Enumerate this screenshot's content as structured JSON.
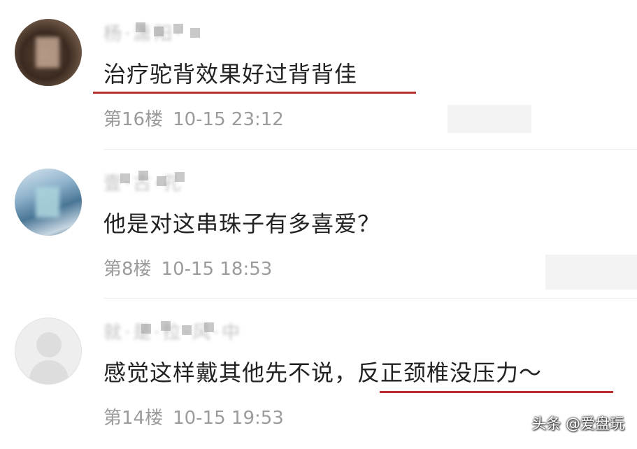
{
  "comments": [
    {
      "username": "杨·潇阳·",
      "text": "治疗驼背效果好过背背佳",
      "floor": "第16楼",
      "time": "10-15 23:12",
      "underlined": true
    },
    {
      "username": "壹·古·孔",
      "text": "他是对这串珠子有多喜爱？",
      "floor": "第8楼",
      "time": "10-15 18:53",
      "underlined": false
    },
    {
      "username": "就·是·拉·风·中",
      "text_plain": "感觉这样戴其他先不说，",
      "text_highlight": "反正颈椎没压力～",
      "floor": "第14楼",
      "time": "10-15 19:53",
      "underlined": true
    }
  ],
  "watermark": "头条 @爱盘玩",
  "colors": {
    "underline": "#b8312f",
    "meta_text": "#9b9b9b",
    "body_text": "#222222"
  }
}
